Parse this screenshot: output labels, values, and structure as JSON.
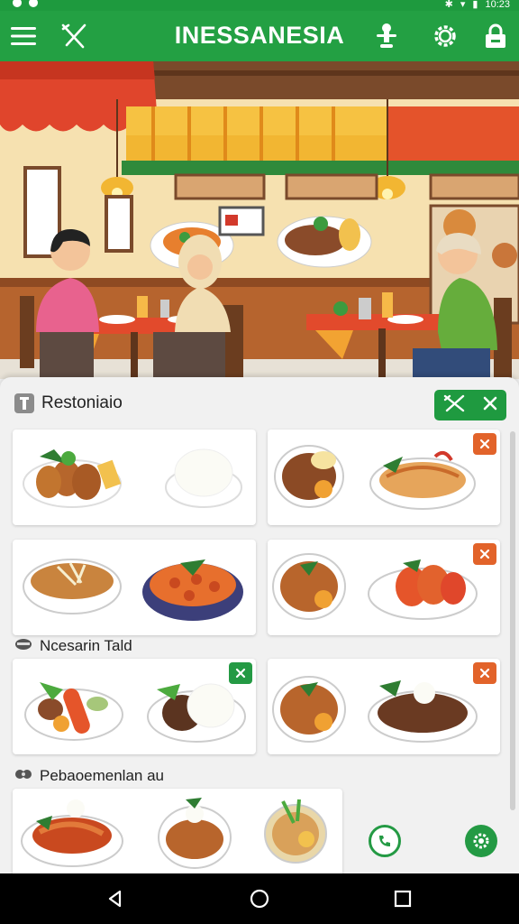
{
  "app": {
    "title": "INESSANESIA"
  },
  "status_bar": {
    "time": "10:23"
  },
  "sections": [
    {
      "title": "Restoniaio"
    },
    {
      "title": "Ncesarin Tald"
    },
    {
      "title": "Pebaoemenlan au"
    }
  ],
  "colors": {
    "brand_green": "#23a043",
    "close_orange": "#e2632a",
    "nav_black": "#000000"
  },
  "icons": {
    "app_bar": [
      "menu-icon",
      "chopsticks-icon",
      "chef-icon",
      "settings-icon",
      "lock-icon"
    ],
    "nav": [
      "back-icon",
      "home-icon",
      "recents-icon"
    ]
  }
}
